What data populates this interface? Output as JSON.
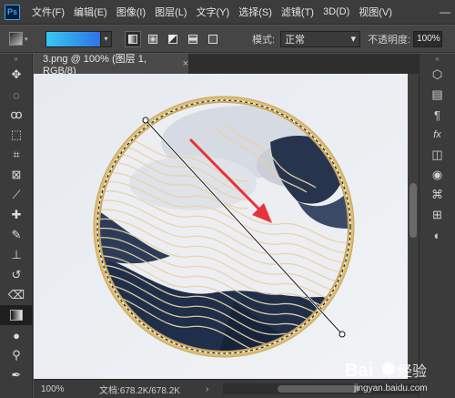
{
  "app": {
    "logo": "Ps"
  },
  "menu": {
    "items": [
      "文件(F)",
      "编辑(E)",
      "图像(I)",
      "图层(L)",
      "文字(Y)",
      "选择(S)",
      "滤镜(T)",
      "3D(D)",
      "视图(V)"
    ]
  },
  "window_controls": {
    "minimize": "—",
    "maximize": "☐",
    "close": "✕"
  },
  "options": {
    "gradient_colors": [
      "#37c7f3",
      "#2f73e6"
    ],
    "mode_label": "模式:",
    "mode_value": "正常",
    "opacity_label": "不透明度:",
    "opacity_value": "100%"
  },
  "document": {
    "tab_title": "3.png @ 100% (图层 1, RGB/8)",
    "tab_close": "×"
  },
  "status": {
    "zoom": "100%",
    "doc_size": "文档:678.2K/678.2K",
    "arrow": "›"
  },
  "toolbar_left": {
    "icons": [
      "move-icon",
      "marquee-icon",
      "lasso-icon",
      "quick-select-icon",
      "crop-icon",
      "frame-icon",
      "eyedropper-icon",
      "healing-icon",
      "brush-icon",
      "stamp-icon",
      "history-brush-icon",
      "eraser-icon",
      "gradient-icon",
      "blur-icon",
      "dodge-icon",
      "pen-icon"
    ]
  },
  "panel_right": {
    "icons": [
      "3d-icon",
      "properties-icon",
      "paragraph-icon",
      "fx-icon",
      "layers-icon",
      "channels-icon",
      "paths-icon",
      "swatches-icon",
      "adjustments-icon"
    ]
  },
  "colors": {
    "frame": "#d9bf7a",
    "ink_dark": "#1f2f4a",
    "lines": "#e8d2a8",
    "arrow": "#e5343a"
  },
  "watermark": {
    "text": "Bai",
    "suffix": "经验",
    "url": "jingyan.baidu.com"
  }
}
